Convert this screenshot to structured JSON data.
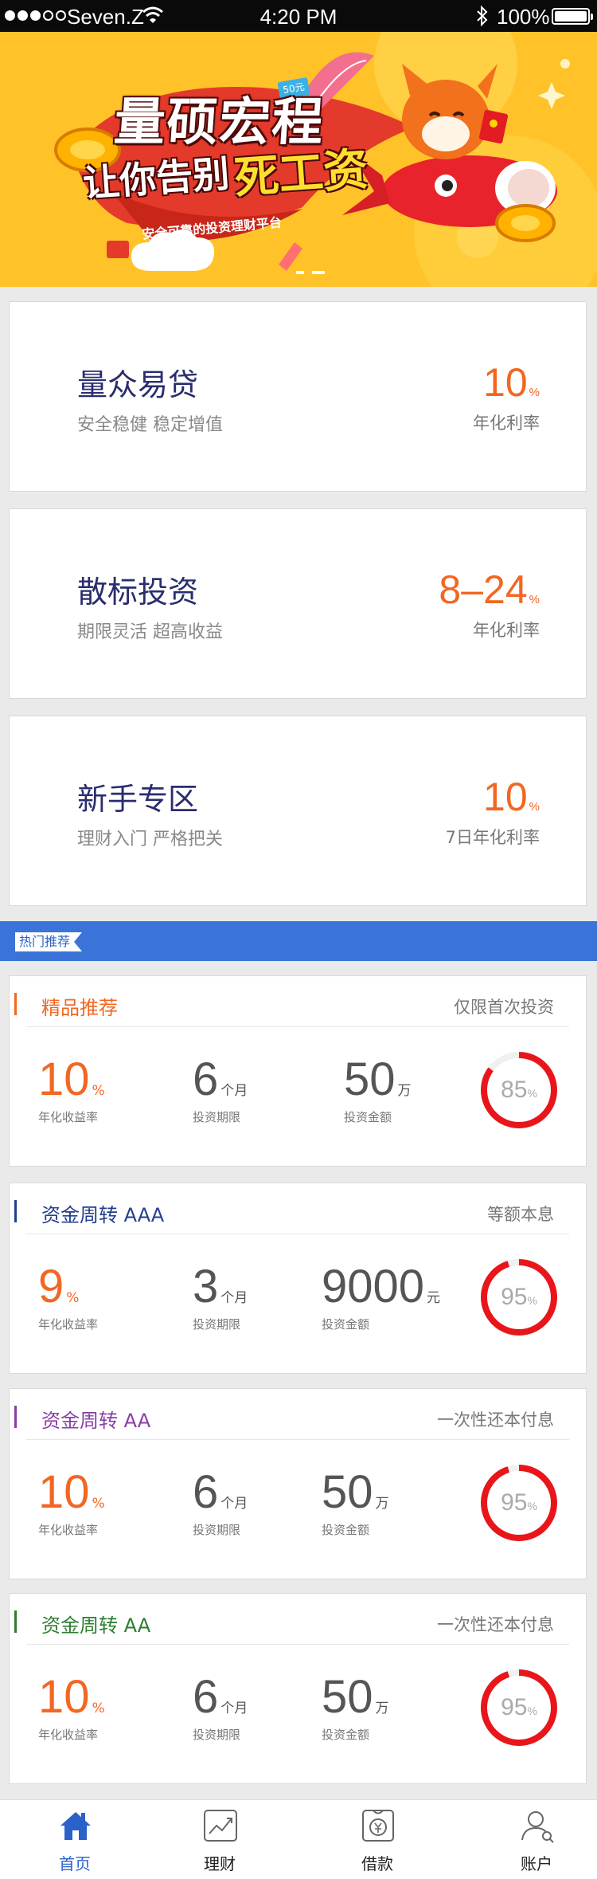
{
  "status_bar": {
    "carrier": "Seven.Z",
    "time": "4:20 PM",
    "battery": "100%"
  },
  "banner": {
    "title": "量硕宏程",
    "subtitle_a": "让你告别",
    "subtitle_b": "死工资",
    "tagline": "安全可靠的投资理财平台",
    "badge": "50元"
  },
  "products": [
    {
      "name": "量众易贷",
      "desc": "安全稳健 稳定增值",
      "rate": "10",
      "rate_unit": "%",
      "rate_label": "年化利率"
    },
    {
      "name": "散标投资",
      "desc": "期限灵活 超高收益",
      "rate": "8–24",
      "rate_unit": "%",
      "rate_label": "年化利率"
    },
    {
      "name": "新手专区",
      "desc": "理财入门 严格把关",
      "rate": "10",
      "rate_unit": "%",
      "rate_label": "7日年化利率"
    }
  ],
  "hot_label": "热门推荐",
  "recommends": [
    {
      "title": "精品推荐",
      "title_color": "#f26722",
      "note": "仅限首次投资",
      "rate": "10",
      "rate_unit": "%",
      "rate_label": "年化收益率",
      "term": "6",
      "term_unit": "个月",
      "term_label": "投资期限",
      "amount": "50",
      "amount_unit": "万",
      "amount_label": "投资金额",
      "progress": "85",
      "progress_unit": "%",
      "progress_value": 85
    },
    {
      "title": "资金周转 AAA",
      "title_color": "#233e8c",
      "note": "等额本息",
      "rate": "9",
      "rate_unit": "%",
      "rate_label": "年化收益率",
      "term": "3",
      "term_unit": "个月",
      "term_label": "投资期限",
      "amount": "9000",
      "amount_unit": "元",
      "amount_label": "投资金额",
      "progress": "95",
      "progress_unit": "%",
      "progress_value": 95
    },
    {
      "title": "资金周转 AA",
      "title_color": "#8a3ea5",
      "note": "一次性还本付息",
      "rate": "10",
      "rate_unit": "%",
      "rate_label": "年化收益率",
      "term": "6",
      "term_unit": "个月",
      "term_label": "投资期限",
      "amount": "50",
      "amount_unit": "万",
      "amount_label": "投资金额",
      "progress": "95",
      "progress_unit": "%",
      "progress_value": 95
    },
    {
      "title": "资金周转 AA",
      "title_color": "#2e7d32",
      "note": "一次性还本付息",
      "rate": "10",
      "rate_unit": "%",
      "rate_label": "年化收益率",
      "term": "6",
      "term_unit": "个月",
      "term_label": "投资期限",
      "amount": "50",
      "amount_unit": "万",
      "amount_label": "投资金额",
      "progress": "95",
      "progress_unit": "%",
      "progress_value": 95
    }
  ],
  "tabs": [
    {
      "label": "首页",
      "icon": "home-icon",
      "active": true
    },
    {
      "label": "理财",
      "icon": "chart-icon",
      "active": false
    },
    {
      "label": "借款",
      "icon": "loan-icon",
      "active": false
    },
    {
      "label": "账户",
      "icon": "user-icon",
      "active": false
    }
  ],
  "colors": {
    "accent": "#f26722",
    "primary": "#3a74d8",
    "ring": "#e8161b",
    "banner": "#ffc329"
  }
}
